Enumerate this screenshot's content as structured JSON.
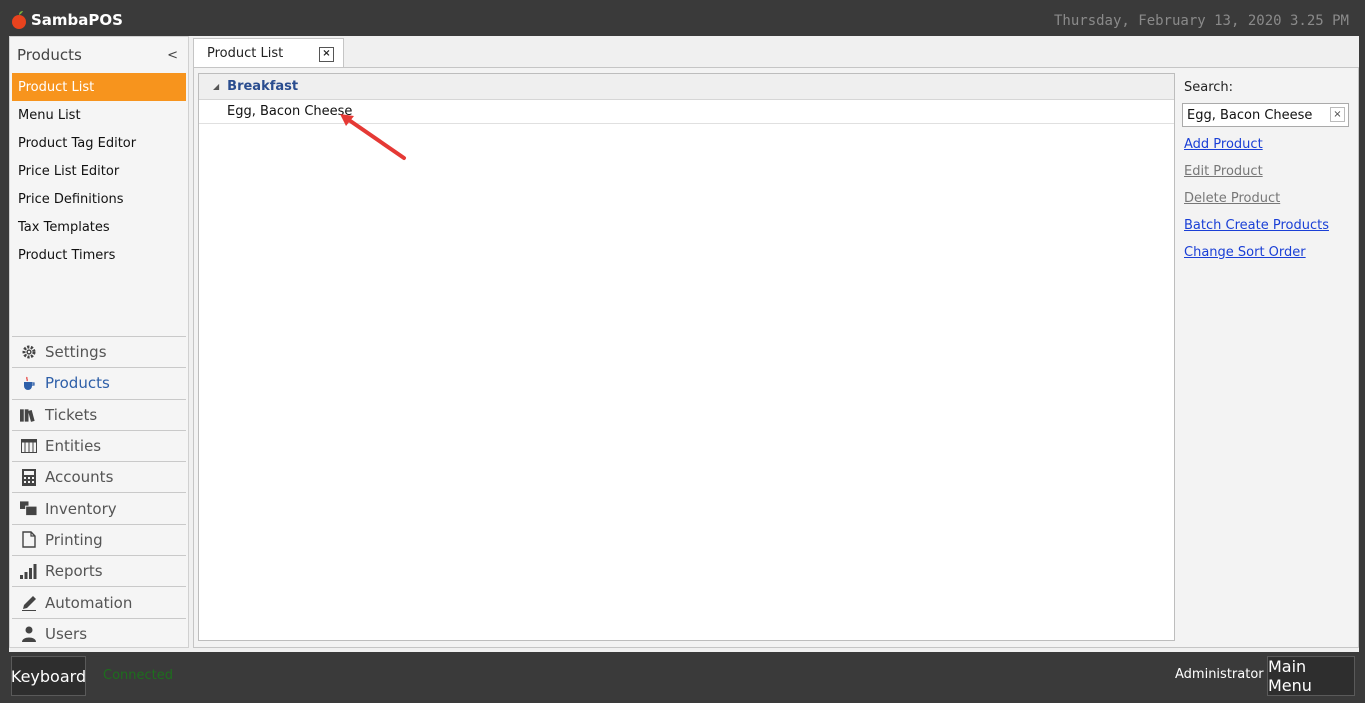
{
  "app": {
    "title": "SambaPOS",
    "datetime": "Thursday, February 13, 2020 3.25 PM"
  },
  "sidebar": {
    "header": "Products",
    "collapse_glyph": "<",
    "items": [
      {
        "label": "Product List",
        "active": true
      },
      {
        "label": "Menu List"
      },
      {
        "label": "Product Tag Editor"
      },
      {
        "label": "Price List Editor"
      },
      {
        "label": "Price Definitions"
      },
      {
        "label": "Tax Templates"
      },
      {
        "label": "Product Timers"
      }
    ],
    "nav": [
      {
        "label": "Settings",
        "icon": "gear-icon"
      },
      {
        "label": "Products",
        "icon": "coffee-cup-icon",
        "active": true
      },
      {
        "label": "Tickets",
        "icon": "books-icon"
      },
      {
        "label": "Entities",
        "icon": "table-grid-icon"
      },
      {
        "label": "Accounts",
        "icon": "calculator-icon"
      },
      {
        "label": "Inventory",
        "icon": "boxes-icon"
      },
      {
        "label": "Printing",
        "icon": "document-icon"
      },
      {
        "label": "Reports",
        "icon": "bar-chart-icon"
      },
      {
        "label": "Automation",
        "icon": "pen-icon"
      },
      {
        "label": "Users",
        "icon": "user-icon"
      }
    ]
  },
  "tabs": [
    {
      "label": "Product List",
      "close": "×"
    }
  ],
  "list": {
    "group": "Breakfast",
    "rows": [
      "Egg, Bacon Cheese"
    ]
  },
  "right_panel": {
    "search_label": "Search:",
    "search_value": "Egg, Bacon Cheese",
    "search_clear": "×",
    "links": [
      {
        "label": "Add Product",
        "enabled": true
      },
      {
        "label": "Edit Product",
        "enabled": false
      },
      {
        "label": "Delete Product",
        "enabled": false
      },
      {
        "label": "Batch Create Products",
        "enabled": true
      },
      {
        "label": "Change Sort Order",
        "enabled": true
      }
    ]
  },
  "bottom": {
    "keyboard": "Keyboard",
    "status": "Connected",
    "user": "Administrator",
    "main_menu": "Main Menu"
  },
  "colors": {
    "accent": "#f7941d",
    "link": "#1a3fd6",
    "group": "#2a4d8f",
    "status": "#1d6e1d",
    "arrow": "#e53935"
  }
}
